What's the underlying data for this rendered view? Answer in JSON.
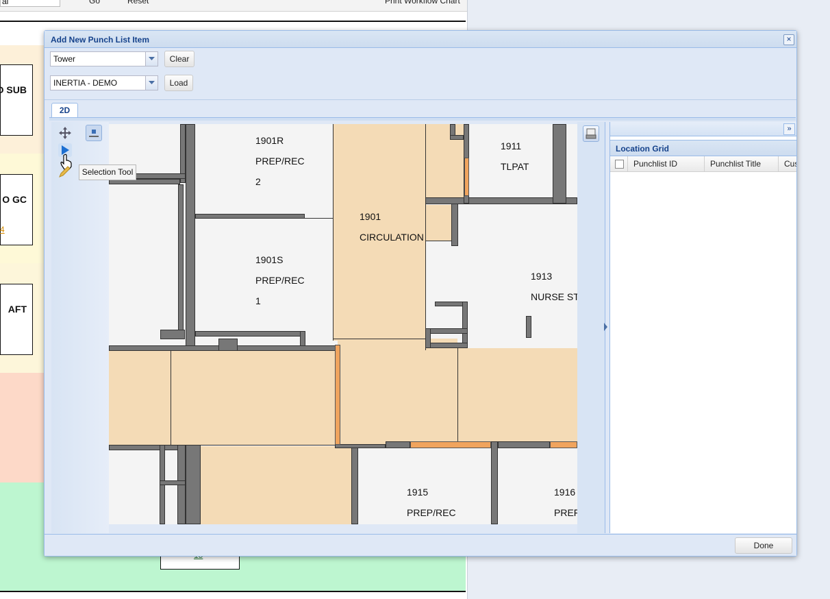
{
  "background": {
    "toolbar_items": [
      "al",
      "Go",
      "Reset",
      "Print Workflow Chart"
    ],
    "cards": [
      "O SUB",
      "O GC",
      "AFT"
    ],
    "card_link": "4",
    "small_box_link": "15"
  },
  "dialog": {
    "title": "Add New Punch List Item",
    "close_icon": "close-icon",
    "building_select": {
      "value": "Tower"
    },
    "project_select": {
      "value": "INERTIA - DEMO"
    },
    "clear_label": "Clear",
    "load_label": "Load",
    "tab_label": "2D",
    "tools": [
      "pan-icon",
      "selection-arrow-icon",
      "pencil-icon",
      "zoom-extent-icon"
    ],
    "tooltip": "Selection Tool",
    "map_labels": [
      {
        "id": "1901R",
        "lines": [
          "1901R",
          "PREP/REC",
          "2"
        ]
      },
      {
        "id": "1911",
        "lines": [
          "1911",
          "TLPAT"
        ]
      },
      {
        "id": "1901",
        "lines": [
          "1901",
          "CIRCULATION"
        ]
      },
      {
        "id": "1901S",
        "lines": [
          "1901S",
          "PREP/REC",
          "1"
        ]
      },
      {
        "id": "1913",
        "lines": [
          "1913",
          "NURSE ST"
        ]
      },
      {
        "id": "1915",
        "lines": [
          "1915",
          "PREP/REC"
        ]
      },
      {
        "id": "1916",
        "lines": [
          "1916",
          "PREF"
        ]
      }
    ],
    "location_grid": {
      "title": "Location Grid",
      "columns": [
        "Punchlist ID",
        "Punchlist Title",
        "Cus"
      ]
    },
    "done_label": "Done"
  },
  "colors": {
    "room_fill": "#f4dbb6",
    "wall": "#777777",
    "accent_wall": "#f0a45e",
    "header_text": "#15428b"
  }
}
